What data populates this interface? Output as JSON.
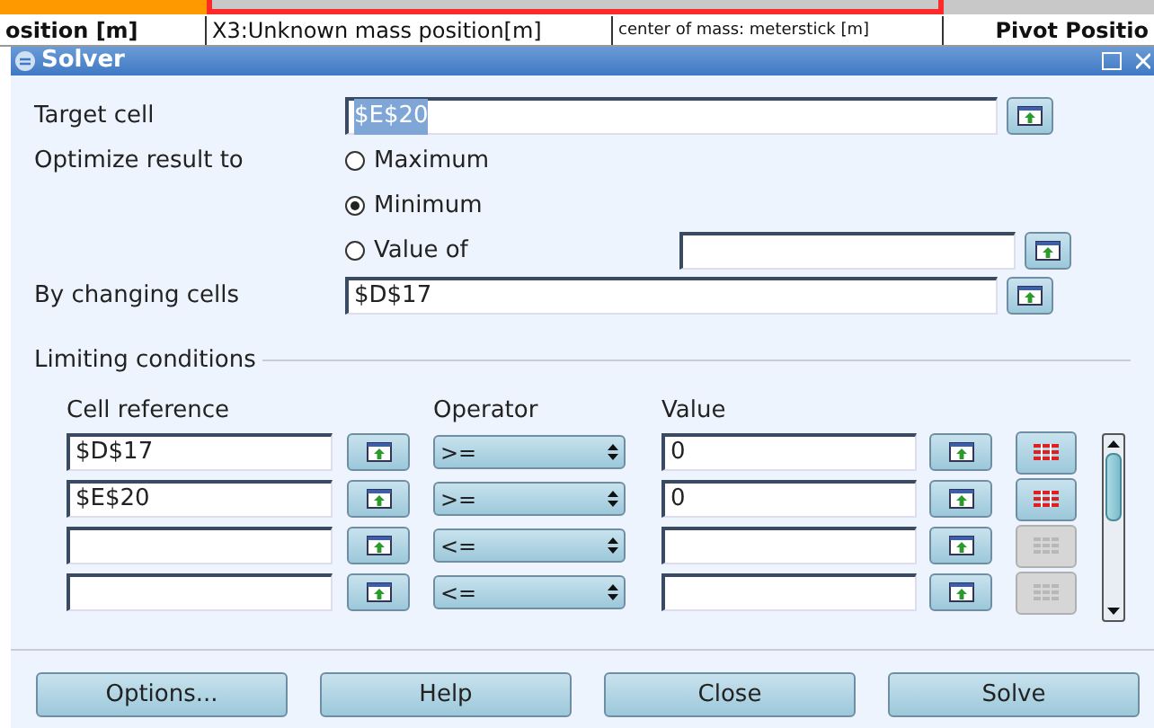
{
  "sheet": {
    "headers": [
      {
        "text": "osition [m]",
        "bold": true
      },
      {
        "text": "X3:Unknown mass position[m]",
        "bold": false
      },
      {
        "text": "center of mass: meterstick [m]",
        "bold": false
      },
      {
        "text": "Pivot Positio",
        "bold": true
      }
    ]
  },
  "window": {
    "title": "Solver"
  },
  "target_cell": {
    "label": "Target cell",
    "value": "$E$20"
  },
  "optimize": {
    "label": "Optimize result to",
    "options": [
      {
        "label": "Maximum",
        "selected": false
      },
      {
        "label": "Minimum",
        "selected": true
      },
      {
        "label": "Value of",
        "selected": false
      }
    ]
  },
  "changing_cells": {
    "label": "By changing cells",
    "value": "$D$17"
  },
  "limiting_conditions": {
    "title": "Limiting conditions",
    "columns": [
      "Cell reference",
      "Operator",
      "Value"
    ],
    "rows": [
      {
        "cell": "$D$17",
        "operator": ">=",
        "value": "0",
        "removable": true
      },
      {
        "cell": "$E$20",
        "operator": ">=",
        "value": "0",
        "removable": true
      },
      {
        "cell": "",
        "operator": "<=",
        "value": "",
        "removable": false
      },
      {
        "cell": "",
        "operator": "<=",
        "value": "",
        "removable": false
      }
    ]
  },
  "buttons": [
    "Options...",
    "Help",
    "Close",
    "Solve"
  ]
}
